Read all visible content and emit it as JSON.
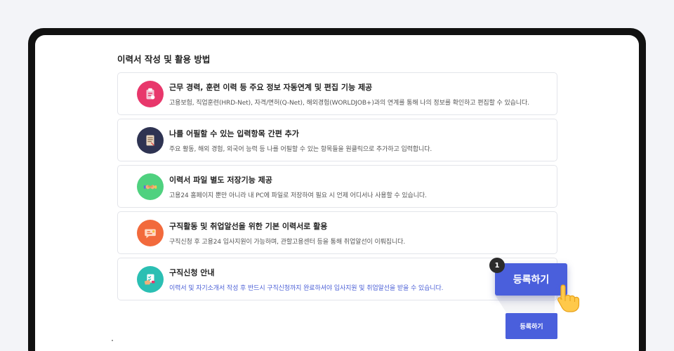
{
  "section_title": "이력서 작성 및 활용 방법",
  "cards": [
    {
      "title": "근무 경력, 훈련 이력 등 주요 정보 자동연계 및 편집 기능 제공",
      "desc": "고용보험, 직업훈련(HRD-Net), 자격/면허(Q-Net), 해외경험(WORLDJOB+)과의 연계를 통해 나의 정보를 확인하고 편집할 수 있습니다.",
      "icon": "document-clipboard-icon",
      "icon_bg": "#e8376b"
    },
    {
      "title": "나를 어필할 수 있는 입력항목 간편 추가",
      "desc": "주요 활동, 해외 경험, 외국어 능력 등 나를 어필할 수 있는 항목들을 원클릭으로 추가하고 입력합니다.",
      "icon": "scroll-icon",
      "icon_bg": "#2e3352"
    },
    {
      "title": "이력서 파일 별도 저장기능 제공",
      "desc": "고용24 홈페이지 뿐만 아니라 내 PC에 파일로 저장하여 필요 시 언제 어디서나 사용할 수 있습니다.",
      "icon": "handshake-icon",
      "icon_bg": "#4fd17f"
    },
    {
      "title": "구직활동 및 취업알선을 위한 기본 이력서로 활용",
      "desc": "구직신청 후 고용24 입사지원이 가능하며, 관할고용센터 등을 통해 취업알선이 이뤄집니다.",
      "icon": "chat-bubble-icon",
      "icon_bg": "#f26a3c"
    },
    {
      "title": "구직신청 안내",
      "desc": "이력서 및 자기소개서 작성 후 반드시 구직신청까지 완료하셔야 입사지원 및 취업알선을 받을 수 있습니다.",
      "icon": "checklist-hand-icon",
      "icon_bg": "#2bbfb3"
    }
  ],
  "step_badge": "1",
  "register_button_large": "등록하기",
  "register_button_small": "등록하기",
  "colors": {
    "accent": "#4a5fdc",
    "highlight_text": "#4b5fd6"
  }
}
